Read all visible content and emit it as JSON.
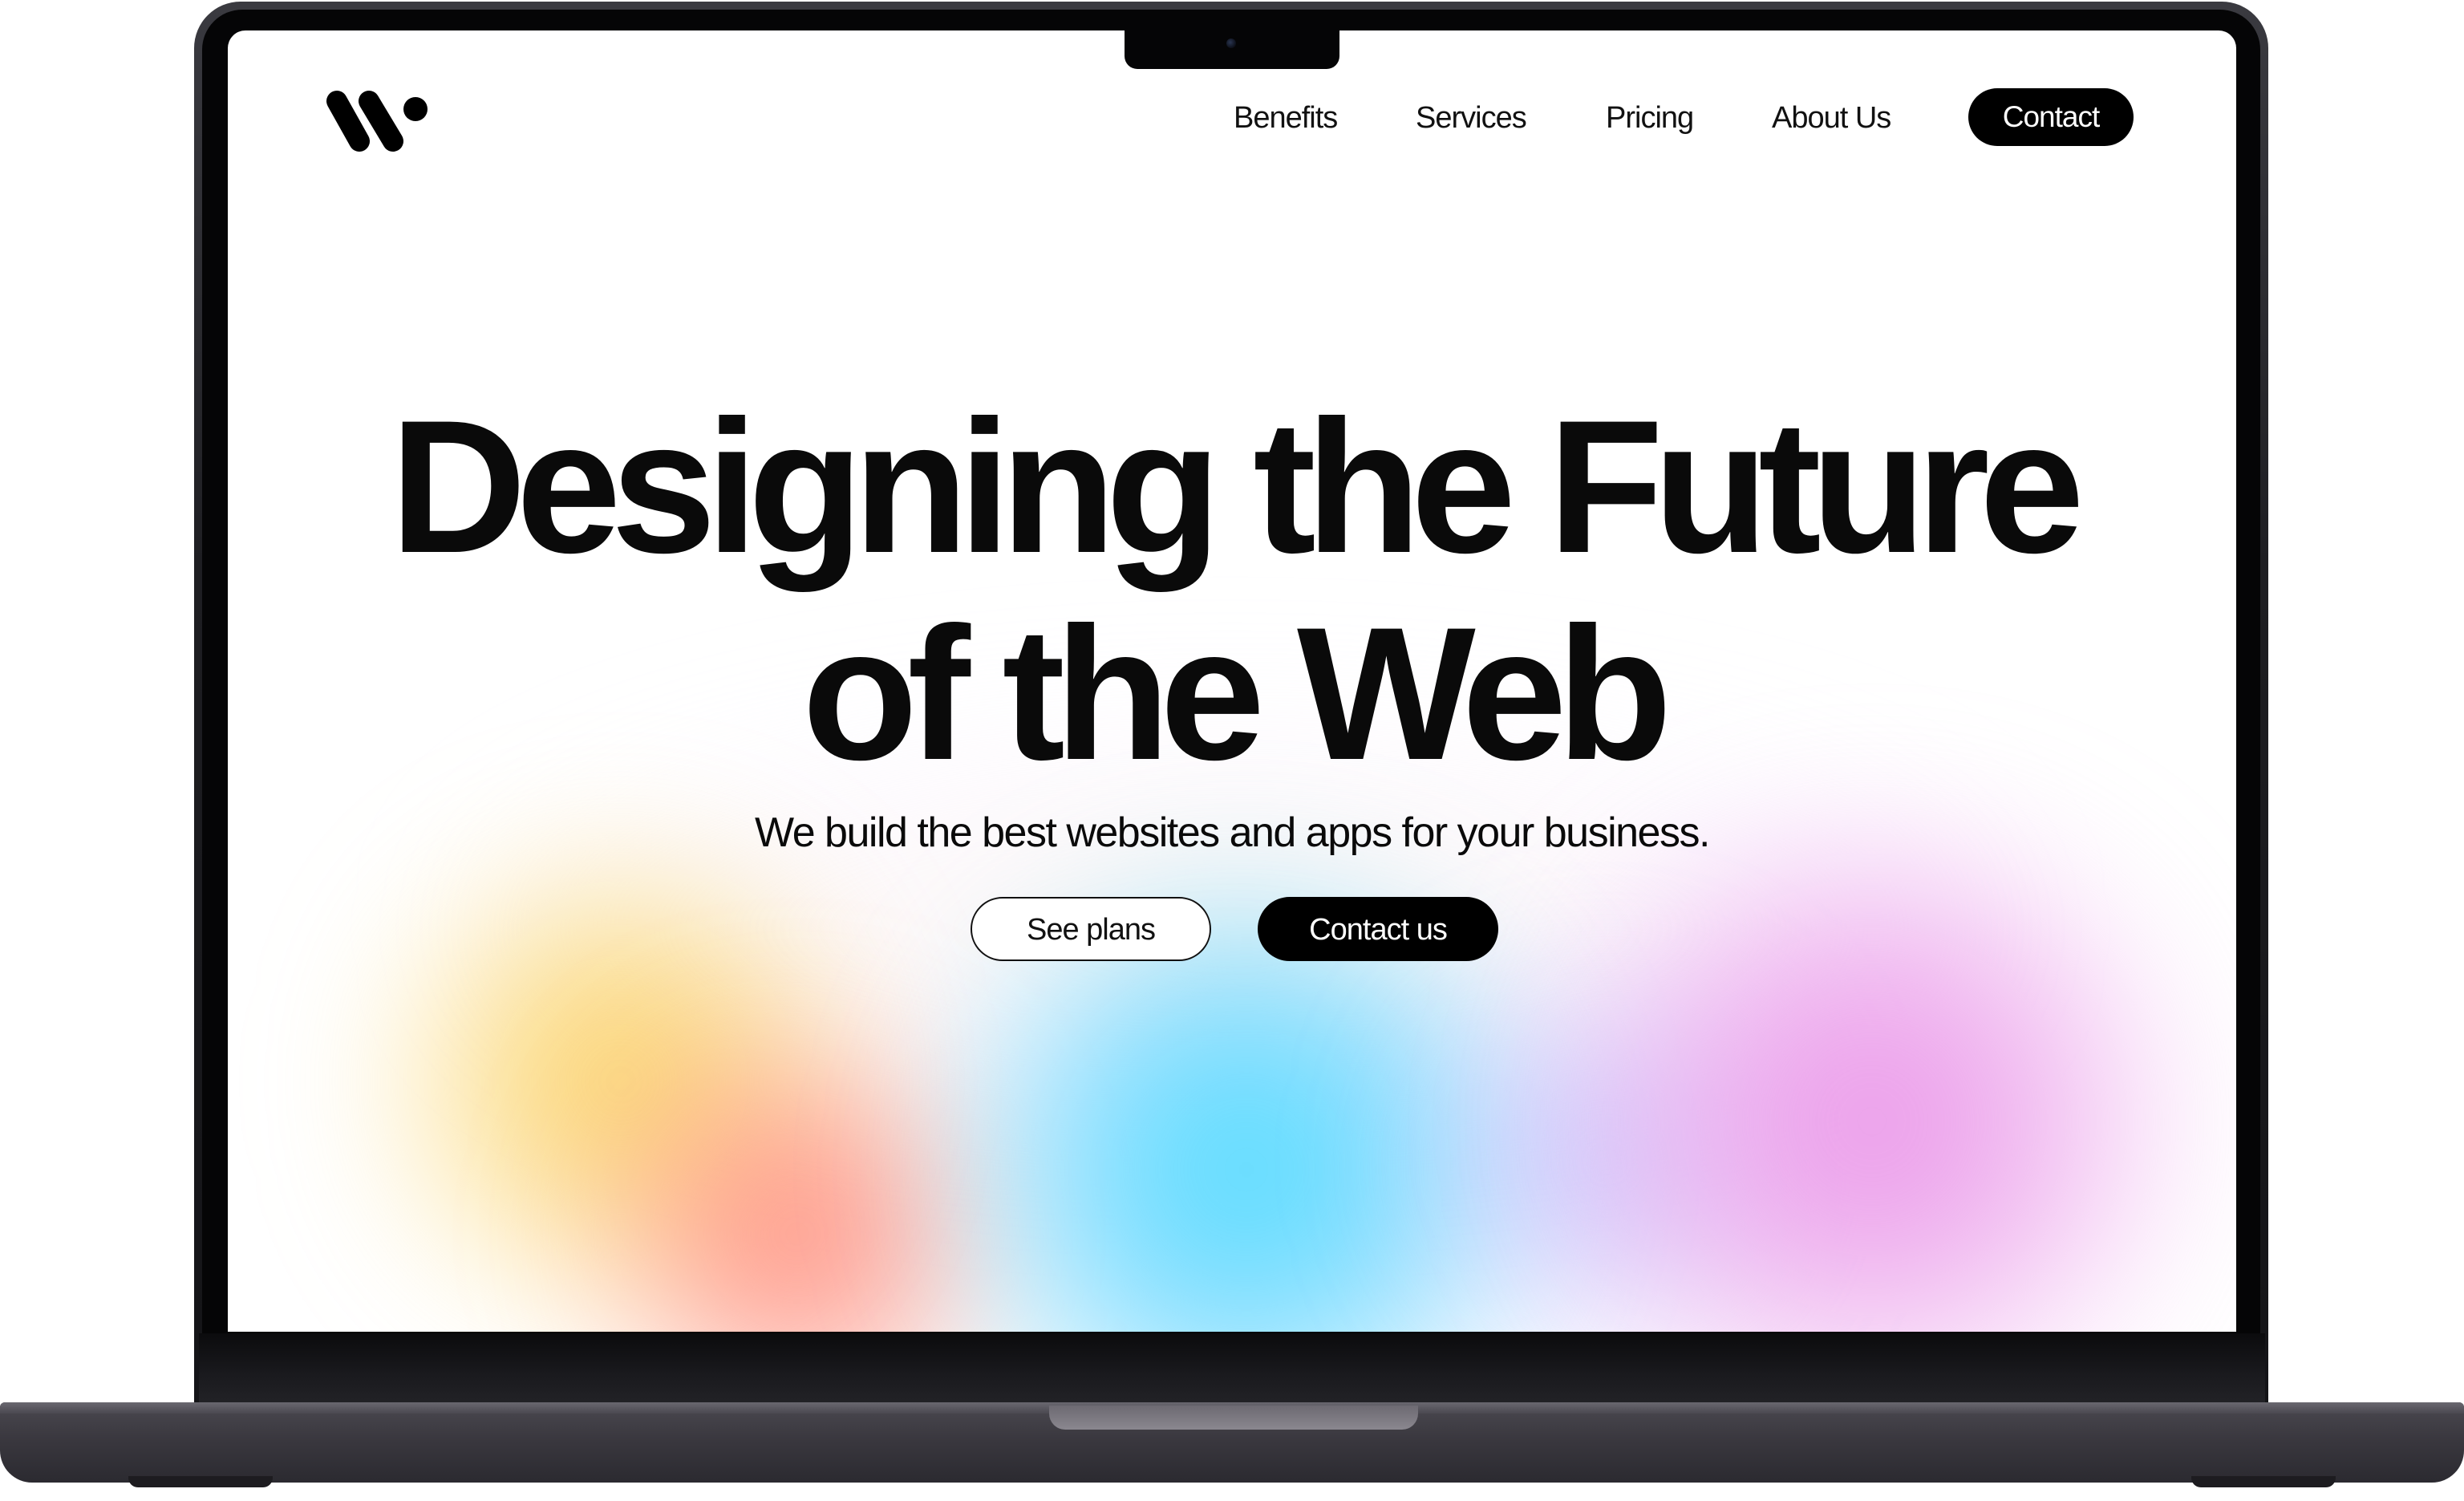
{
  "brand": {
    "logo_icon": "w-logo-icon"
  },
  "nav": {
    "items": [
      {
        "label": "Benefits"
      },
      {
        "label": "Services"
      },
      {
        "label": "Pricing"
      },
      {
        "label": "About Us"
      }
    ],
    "cta_label": "Contact"
  },
  "hero": {
    "title_line_1": "Designing the Future",
    "title_line_2": "of the Web",
    "subtitle": "We build the best websites and apps for your business.",
    "primary_button": "Contact us",
    "secondary_button": "See plans"
  },
  "colors": {
    "text": "#0a0a0a",
    "button_dark": "#000000",
    "blob_yellow": "#facc50",
    "blob_orange": "#ff786e",
    "blob_blue": "#46dcff",
    "blob_pink": "#e88ce6"
  }
}
